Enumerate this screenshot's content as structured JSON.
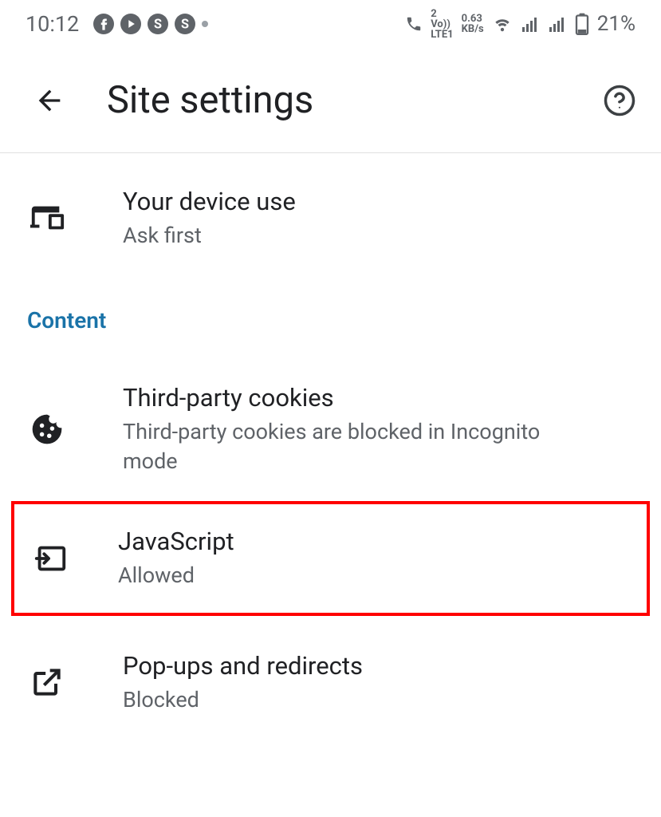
{
  "status": {
    "time": "10:12",
    "volte": {
      "top": "2",
      "bottom": "LTE1",
      "label": "Vo))"
    },
    "data": {
      "top": "0.63",
      "bottom": "KB/s"
    },
    "battery": "21%"
  },
  "header": {
    "title": "Site settings"
  },
  "section": {
    "content_label": "Content"
  },
  "items": {
    "device": {
      "title": "Your device use",
      "subtitle": "Ask first"
    },
    "cookies": {
      "title": "Third-party cookies",
      "subtitle": "Third-party cookies are blocked in Incognito mode"
    },
    "javascript": {
      "title": "JavaScript",
      "subtitle": "Allowed"
    },
    "popups": {
      "title": "Pop-ups and redirects",
      "subtitle": "Blocked"
    }
  }
}
